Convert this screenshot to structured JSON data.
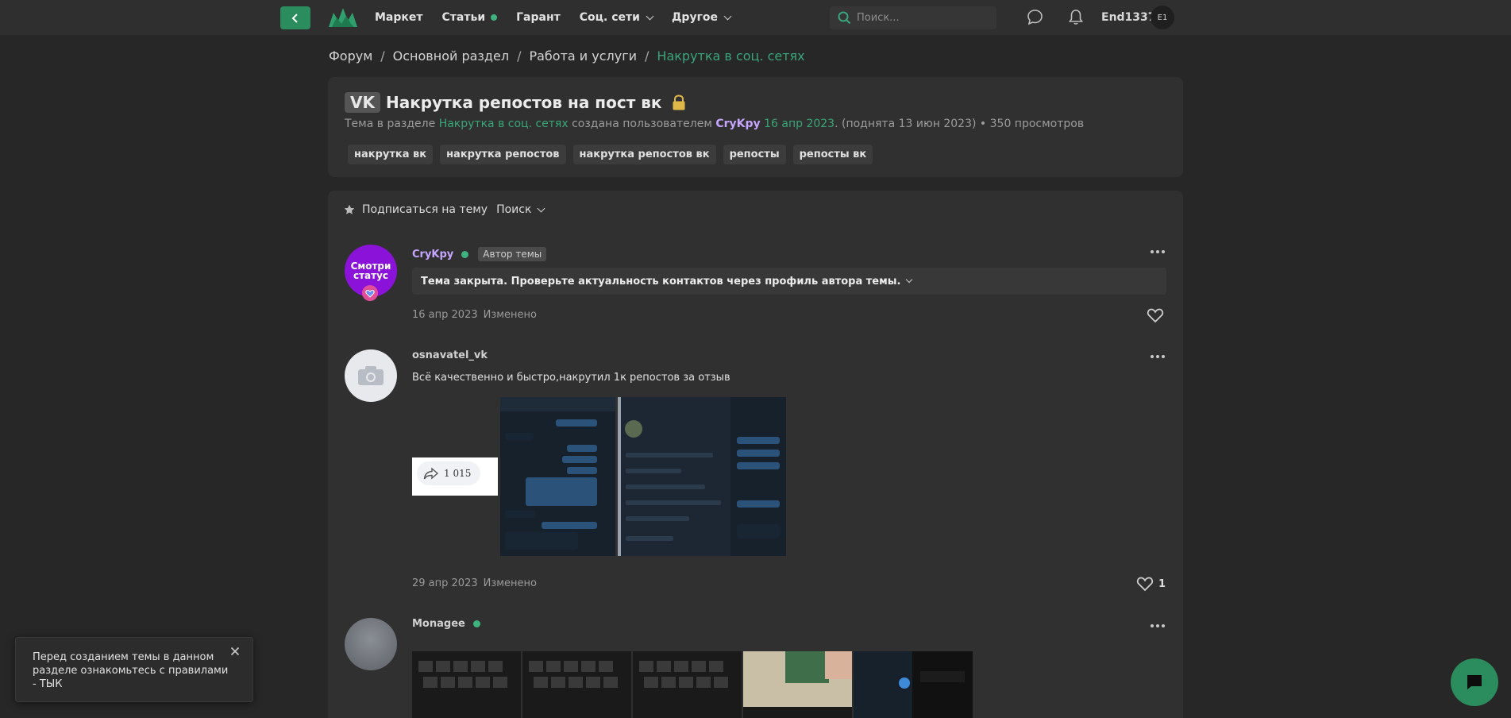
{
  "nav": {
    "items": [
      {
        "label": "Маркет"
      },
      {
        "label": "Статьи",
        "dot": true
      },
      {
        "label": "Гарант"
      },
      {
        "label": "Соц. сети",
        "dropdown": true
      },
      {
        "label": "Другое",
        "dropdown": true
      }
    ],
    "search_placeholder": "Поиск...",
    "username": "End1337",
    "avatar_initials": "E1"
  },
  "breadcrumb": [
    "Форум",
    "Основной раздел",
    "Работа и услуги",
    "Накрутка в соц. сетях"
  ],
  "thread": {
    "prefix": "VK",
    "title": "Накрутка репостов на пост вк",
    "meta": {
      "t1": "Тема в разделе",
      "section": "Накрутка в соц. сетях",
      "t2": "создана пользователем",
      "author": "CryKpy",
      "date": "16 апр 2023",
      "raised": ". (поднята 13 июн 2023)",
      "views": "• 350 просмотров"
    },
    "tags": [
      "накрутка вк",
      "накрутка репостов",
      "накрутка репостов вк",
      "репосты",
      "репосты вк"
    ]
  },
  "actions": {
    "subscribe": "Подписаться на тему",
    "search": "Поиск"
  },
  "posts": [
    {
      "author": "CryKpy",
      "avatar_text": "Смотри статус",
      "badge": "Автор темы",
      "notice": "Тема закрыта. Проверьте актуальность контактов через профиль автора темы.",
      "date": "16 апр 2023",
      "edited": "Изменено"
    },
    {
      "author": "osnavatel_vk",
      "text": "Всё качественно и быстро,накрутил 1к репостов за отзыв",
      "repost_count": "1 015",
      "date": "29 апр 2023",
      "edited": "Изменено",
      "likes": "1"
    },
    {
      "author": "Monagee"
    }
  ],
  "toast": {
    "text": "Перед созданием темы в данном разделе ознакомьтесь с правилами - ТЫК"
  },
  "colors": {
    "accent": "#2b8c5e",
    "link": "#39a678",
    "background": "#272727",
    "card": "#303030"
  }
}
